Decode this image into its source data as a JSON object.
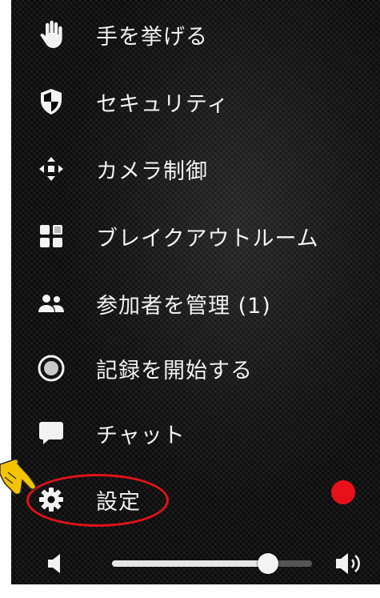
{
  "menu": {
    "items": [
      {
        "label": "手を挙げる",
        "icon": "raise-hand-icon"
      },
      {
        "label": "セキュリティ",
        "icon": "shield-icon"
      },
      {
        "label": "カメラ制御",
        "icon": "camera-control-icon"
      },
      {
        "label": "ブレイクアウトルーム",
        "icon": "breakout-rooms-icon"
      },
      {
        "label": "参加者を管理 (1)",
        "icon": "participants-icon"
      },
      {
        "label": "記録を開始する",
        "icon": "record-icon"
      },
      {
        "label": "チャット",
        "icon": "chat-icon"
      },
      {
        "label": "設定",
        "icon": "gear-icon"
      }
    ]
  },
  "volume": {
    "level": 0.78,
    "low_icon": "speaker-low-icon",
    "high_icon": "speaker-high-icon"
  },
  "annotations": {
    "highlight_color": "#e0121b",
    "dot_color": "#e8101a",
    "pointer_icon": "pointing-hand-icon"
  }
}
